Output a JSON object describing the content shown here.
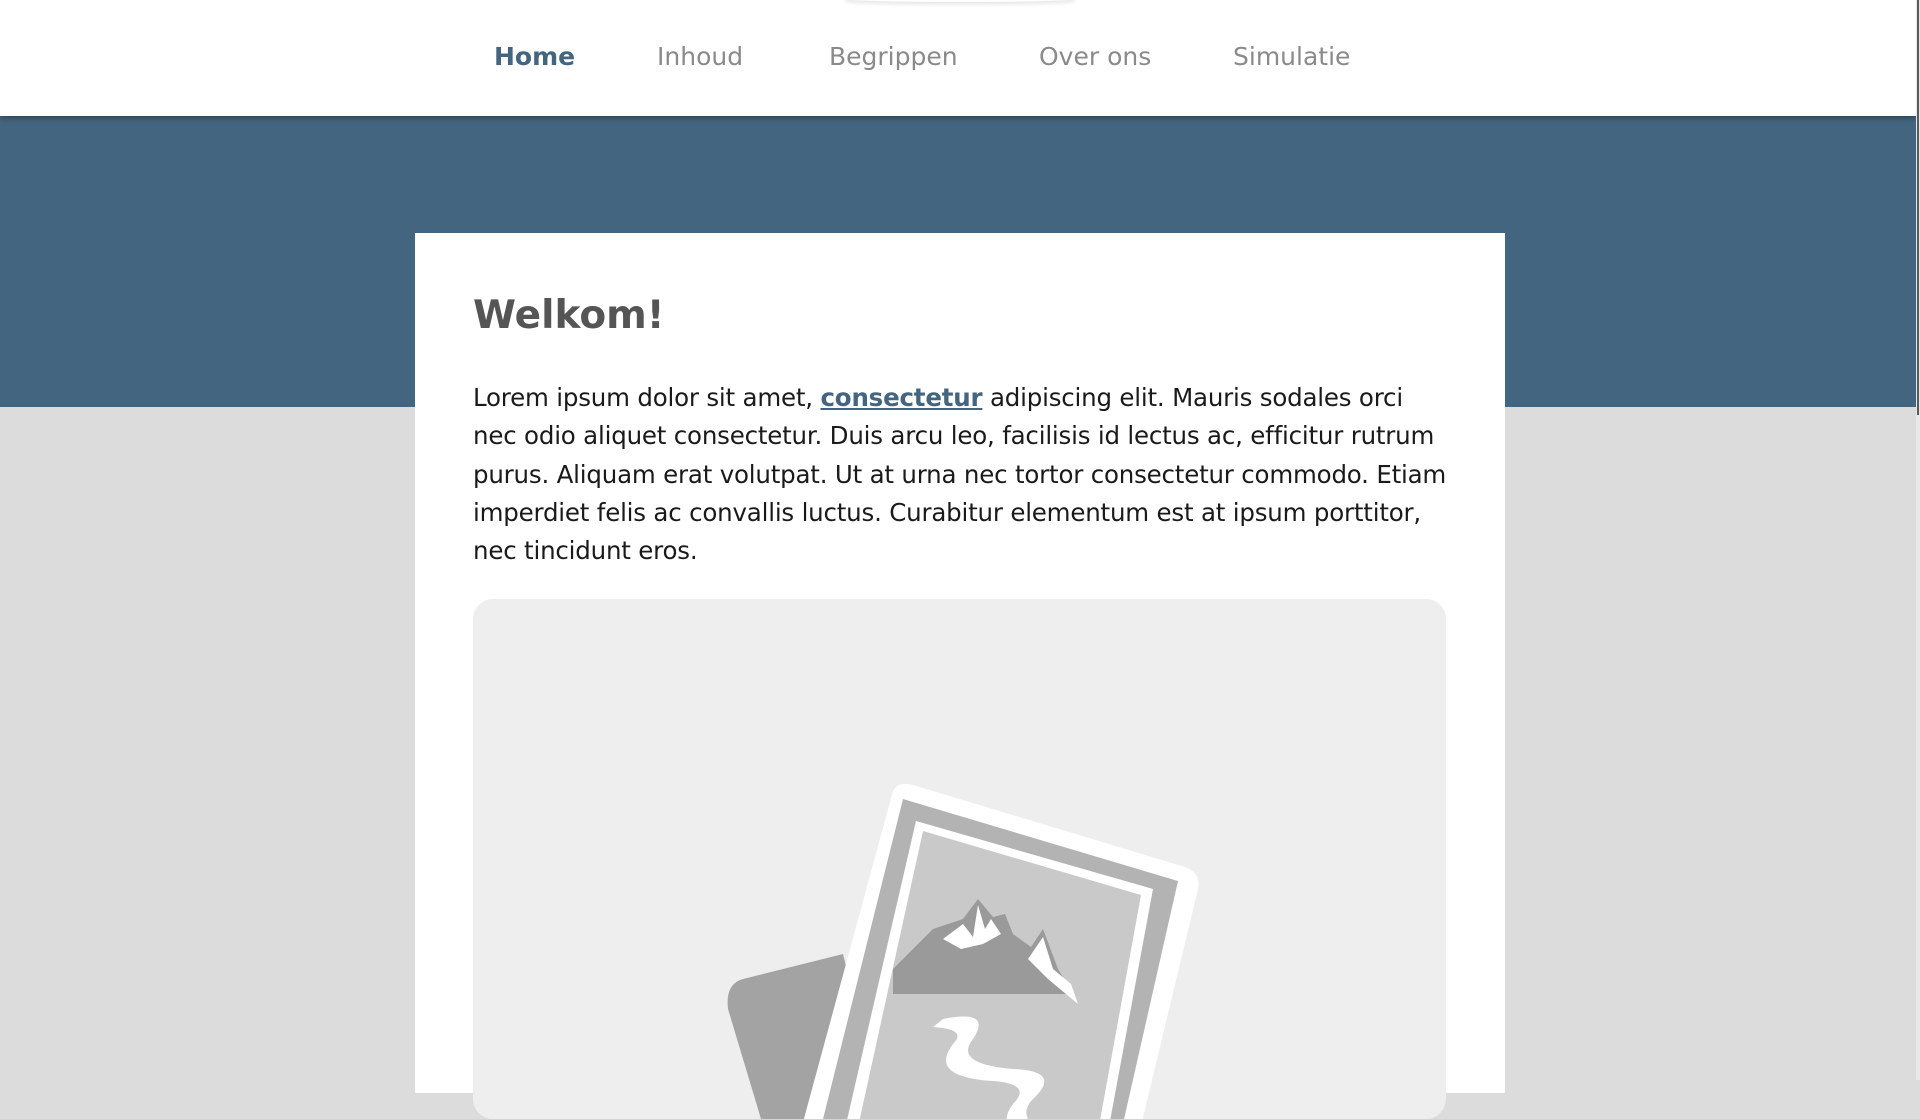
{
  "nav": {
    "items": [
      {
        "label": "Home",
        "active": true
      },
      {
        "label": "Inhoud",
        "active": false
      },
      {
        "label": "Begrippen",
        "active": false
      },
      {
        "label": "Over ons",
        "active": false
      },
      {
        "label": "Simulatie",
        "active": false
      }
    ]
  },
  "main": {
    "title": "Welkom!",
    "intro_before_link": "Lorem ipsum dolor sit amet, ",
    "intro_link": "consectetur",
    "intro_after_link": " adipiscing elit. Mauris sodales orci nec odio aliquet consectetur. Duis arcu leo, facilisis id lectus ac, efficitur rutrum purus. Aliquam erat volutpat. Ut at urna nec tortor consectetur commodo. Etiam imperdiet felis ac convallis luctus. Curabitur elementum est at ipsum porttitor, nec tincidunt eros.",
    "image_icon": "image-placeholder-icon"
  },
  "colors": {
    "accent": "#436580",
    "page_background": "#dcdcdc",
    "card_background": "#ffffff",
    "placeholder_background": "#eeeeee"
  }
}
